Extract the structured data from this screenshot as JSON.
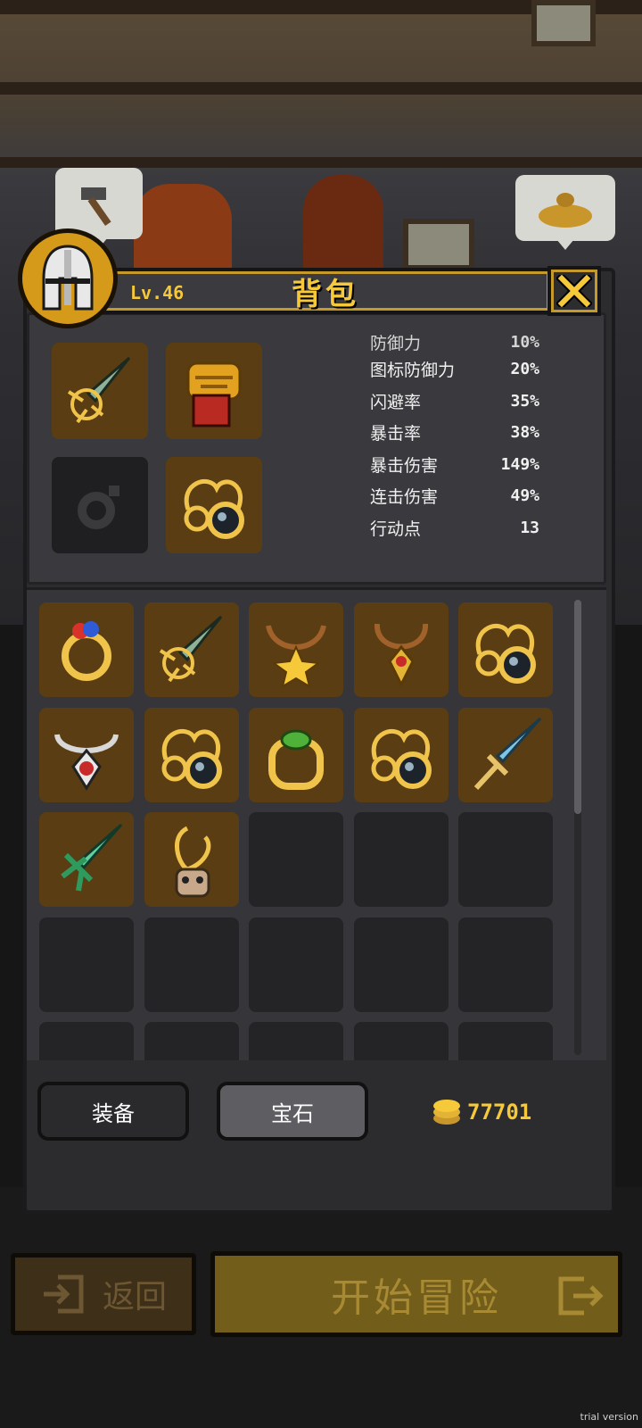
{
  "panel": {
    "title": "背包",
    "level": "Lv.46",
    "close_label": "X"
  },
  "equipped": [
    {
      "icon": "sword-icon",
      "filled": true
    },
    {
      "icon": "armor-icon",
      "filled": true
    },
    {
      "icon": "empty-ring-slot-icon",
      "filled": false
    },
    {
      "icon": "amulet-icon",
      "filled": true
    }
  ],
  "stats": [
    {
      "label": "防御力",
      "value": "10%"
    },
    {
      "label": "图标防御力",
      "value": "20%"
    },
    {
      "label": "闪避率",
      "value": "35%"
    },
    {
      "label": "暴击率",
      "value": "38%"
    },
    {
      "label": "暴击伤害",
      "value": "149%"
    },
    {
      "label": "连击伤害",
      "value": "49%"
    },
    {
      "label": "行动点",
      "value": "13"
    }
  ],
  "inventory": [
    "ring-icon",
    "sword-icon",
    "star-necklace-icon",
    "pendant-icon",
    "amulet-icon",
    "ruby-necklace-icon",
    "amulet-icon",
    "emerald-ring-icon",
    "amulet-icon",
    "ice-sword-icon",
    "green-sword-icon",
    "skull-necklace-icon",
    "",
    "",
    "",
    "",
    "",
    "",
    "",
    "",
    "",
    "",
    "",
    "",
    ""
  ],
  "tabs": {
    "equipment": "装备",
    "gems": "宝石"
  },
  "coins": "77701",
  "buttons": {
    "back": "返回",
    "start": "开始冒险"
  },
  "watermark": "trial version",
  "colors": {
    "gold": "#f5c93a",
    "item_bg": "#5a3d12",
    "empty_bg": "#242426"
  }
}
